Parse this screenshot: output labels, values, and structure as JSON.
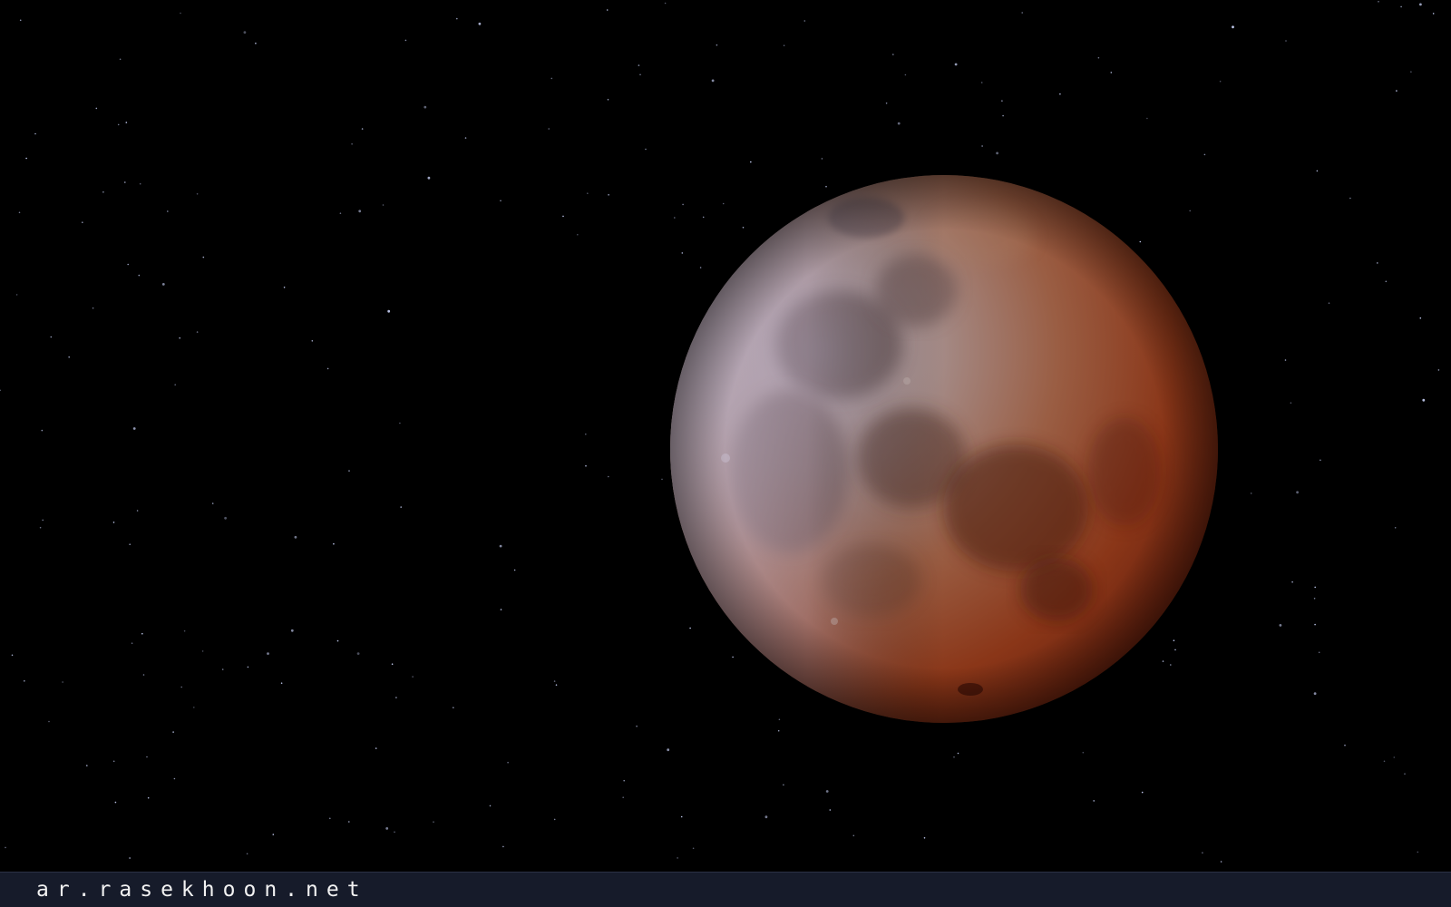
{
  "photo": {
    "subject": "total lunar eclipse",
    "colors": {
      "sky": "#000000",
      "moon_lit_limb": "#b8aebe",
      "moon_mid": "#9a6a55",
      "moon_shadow": "#8a2c12",
      "moon_deep_shadow": "#5a1a0a",
      "star": "#cfd8ff"
    }
  },
  "watermark": {
    "text": "ar.rasekhoon.net",
    "bar_color": "#161b2a",
    "text_color": "#f2f2f2"
  }
}
